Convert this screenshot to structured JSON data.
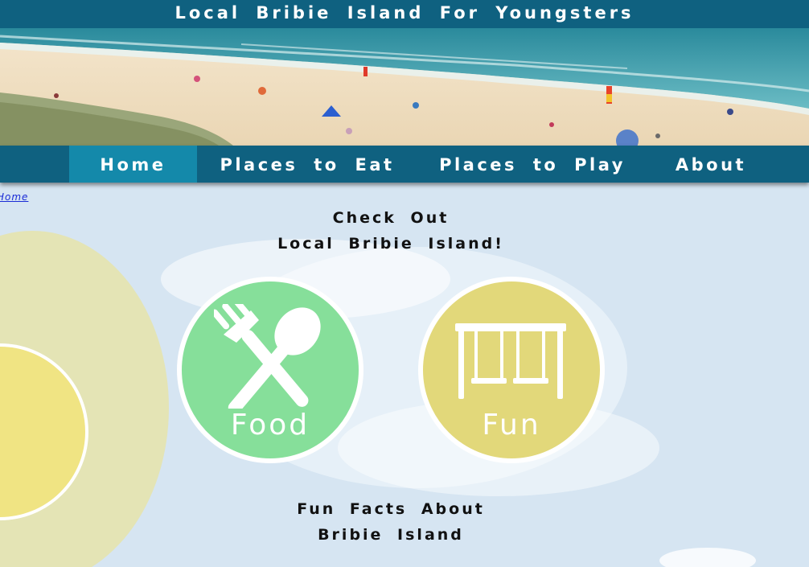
{
  "site": {
    "title": "Local Bribie Island For Youngsters"
  },
  "nav": {
    "items": [
      {
        "label": "Home",
        "active": true
      },
      {
        "label": "Places to Eat",
        "active": false
      },
      {
        "label": "Places to Play",
        "active": false
      },
      {
        "label": "About",
        "active": false
      }
    ]
  },
  "breadcrumb": {
    "label": "Home"
  },
  "intro": {
    "line1": "Check Out",
    "line2": "Local Bribie Island!"
  },
  "cards": {
    "food": {
      "label": "Food",
      "icon": "fork-spoon-icon",
      "color": "#86df9a"
    },
    "fun": {
      "label": "Fun",
      "icon": "swing-set-icon",
      "color": "#e2d87a"
    }
  },
  "facts": {
    "line1": "Fun Facts About",
    "line2": "Bribie Island"
  },
  "colors": {
    "header": "#0f6180",
    "nav_active": "#1489aa",
    "page_background": "#d6e5f2",
    "sun": "#f0e483"
  }
}
